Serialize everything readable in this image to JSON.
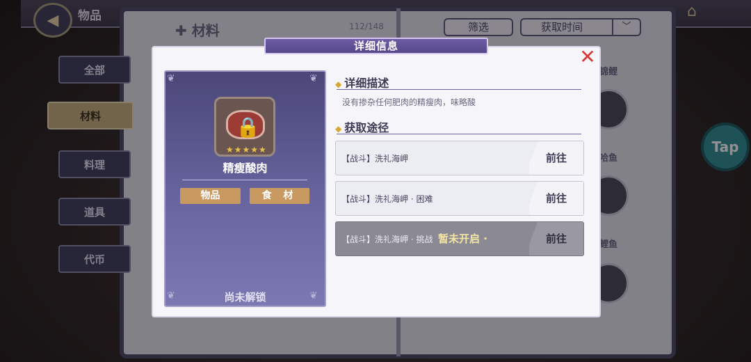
{
  "header": {
    "title": "物品",
    "back_icon": "back-arrow-icon",
    "home_icon": "home-icon"
  },
  "collection": {
    "section_title": "材料",
    "counter": "112/148",
    "filter_label": "筛选",
    "sort_label": "获取时间"
  },
  "category_tabs": [
    {
      "label": "全部",
      "active": false
    },
    {
      "label": "材料",
      "active": true
    },
    {
      "label": "料理",
      "active": false
    },
    {
      "label": "道具",
      "active": false
    },
    {
      "label": "代币",
      "active": false
    }
  ],
  "background_items": [
    "锦鲤",
    "哈鱼",
    "鲤鱼"
  ],
  "floating_button": {
    "label": "Tap"
  },
  "modal": {
    "title": "详细信息",
    "item": {
      "name": "精瘦酸肉",
      "stars": 5,
      "tag_type": "物品",
      "tag_subtype": "食 材",
      "locked_text": "尚未解锁"
    },
    "description_title": "详细描述",
    "description": "没有掺杂任何肥肉的精瘦肉，味略酸",
    "sources_title": "获取途径",
    "sources": [
      {
        "label": "【战斗】洗礼海岬",
        "button": "前往",
        "available": true
      },
      {
        "label": "【战斗】洗礼海岬 · 困难",
        "button": "前往",
        "available": true
      },
      {
        "label": "【战斗】洗礼海岬 · 挑战",
        "button": "前往",
        "available": false,
        "status": "暂未开启 ·"
      }
    ]
  },
  "colors": {
    "modal_bg": "#f6f5fa",
    "title_bar": "#5f519a",
    "card_bg": "#5a568d",
    "tag_bg": "#c89a62",
    "close": "#d43a36",
    "accent_diamond": "#d8a830"
  }
}
